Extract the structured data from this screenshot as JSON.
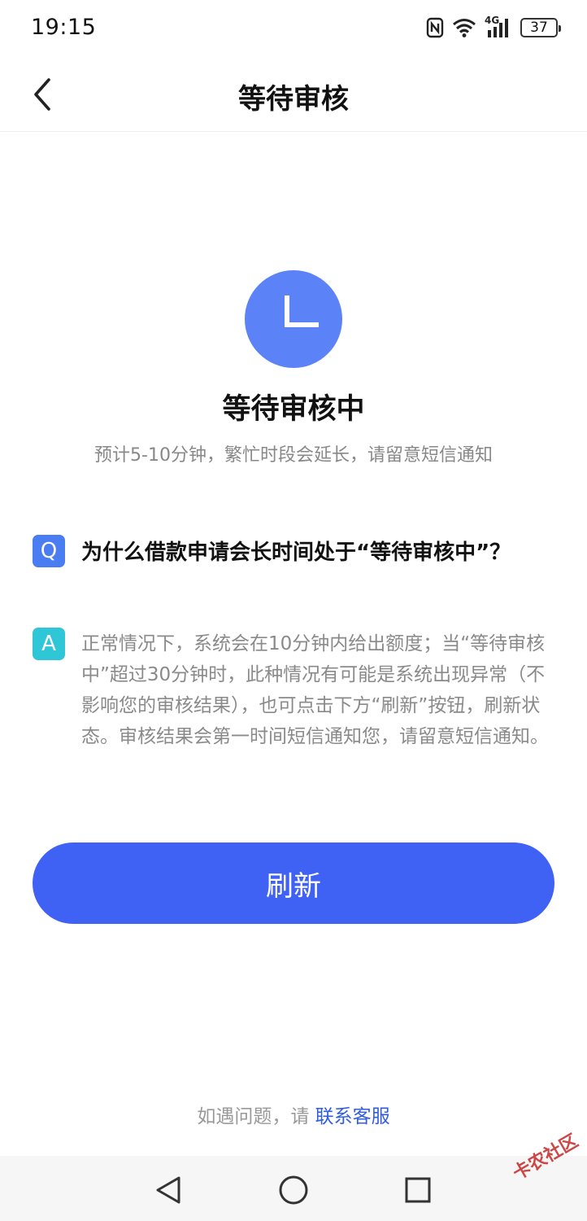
{
  "status_bar": {
    "time": "19:15",
    "signal_label": "4G",
    "battery": "37",
    "icons": [
      "nfc-icon",
      "wifi-icon",
      "signal-icon",
      "battery-icon"
    ]
  },
  "nav": {
    "title": "等待审核",
    "back_icon": "chevron-left-icon"
  },
  "status": {
    "icon": "clock-icon",
    "icon_color": "#5b82f7",
    "heading": "等待审核中",
    "subtitle": "预计5-10分钟，繁忙时段会延长，请留意短信通知"
  },
  "faq": {
    "q_badge": "Q",
    "question": "为什么借款申请会长时间处于“等待审核中”？",
    "a_badge": "A",
    "answer": "正常情况下，系统会在10分钟内给出额度；当“等待审核中”超过30分钟时，此种情况有可能是系统出现异常（不影响您的审核结果），也可点击下方“刷新”按钮，刷新状态。审核结果会第一时间短信通知您，请留意短信通知。"
  },
  "refresh_button": {
    "label": "刷新",
    "color": "#3f62f5"
  },
  "footer": {
    "prefix": "如遇问题，请 ",
    "link": "联系客服"
  },
  "system_nav": {
    "icons": [
      "back-triangle-icon",
      "home-circle-icon",
      "recents-square-icon"
    ]
  },
  "watermark": "卡农社区"
}
